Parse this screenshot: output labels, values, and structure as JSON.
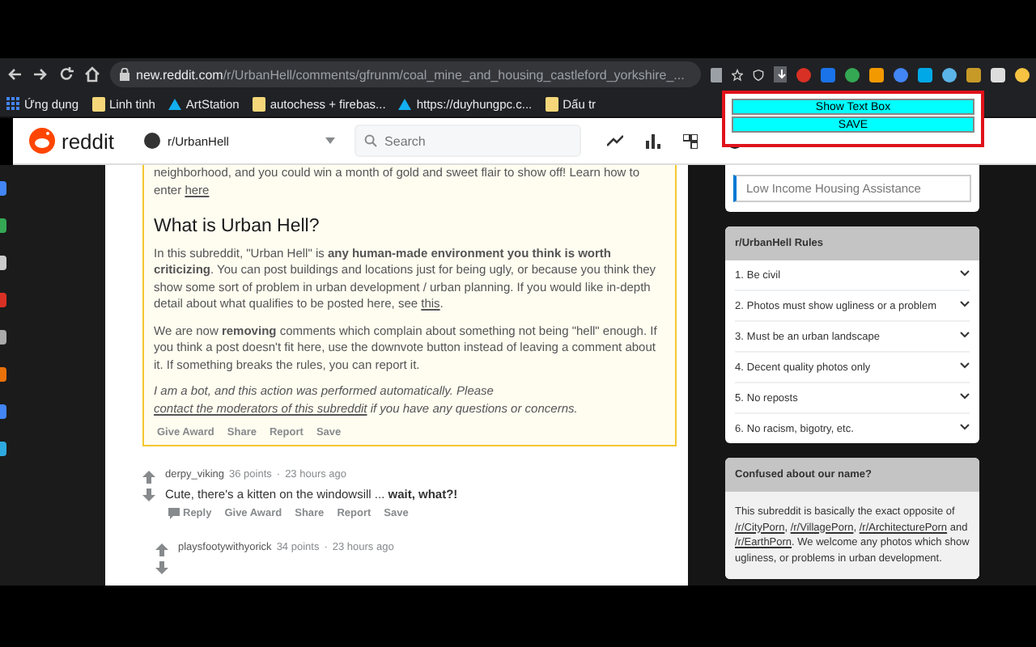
{
  "browser": {
    "url_domain": "new.reddit.com",
    "url_path": "/r/UrbanHell/comments/gfrunm/coal_mine_and_housing_castleford_yorkshire_..."
  },
  "bookmarks": [
    {
      "label": "Ứng dụng",
      "kind": "apps"
    },
    {
      "label": "Linh tinh",
      "kind": "folder"
    },
    {
      "label": "ArtStation",
      "kind": "site"
    },
    {
      "label": "autochess + firebas...",
      "kind": "folder"
    },
    {
      "label": "https://duyhungpc.c...",
      "kind": "site"
    },
    {
      "label": "Dấu tr",
      "kind": "folder"
    }
  ],
  "extension_popup": {
    "buttons": [
      "Show Text Box",
      "SAVE"
    ]
  },
  "header": {
    "logo": "reddit",
    "community": "r/UrbanHell",
    "search": {
      "placeholder": "Search"
    }
  },
  "post_card": {
    "intro": [
      {
        "kind": "text",
        "text": "neighborhood, and you could win a month of gold and sweet flair to show off! Learn how to enter "
      },
      {
        "kind": "link",
        "text": "here"
      }
    ],
    "heading": "What is Urban Hell?",
    "paragraphs": [
      [
        {
          "kind": "text",
          "text": "In this subreddit, \"Urban Hell\" is **any human-made environment you think is worth criticizing**. You can post buildings and locations just for being ugly, or because you think they show some sort of problem in urban development / urban planning. If you would like in-depth detail about what qualifies to be posted here, see "
        },
        {
          "kind": "link",
          "text": "this"
        },
        {
          "kind": "text",
          "text": "."
        }
      ],
      [
        {
          "kind": "text",
          "text": "We are now **removing** comments which complain about something not being \"hell\" enough. If you think a post doesn't fit here, use the downvote button instead of leaving a comment about it. If something breaks the rules, you can report it."
        }
      ]
    ],
    "bot_note": [
      {
        "kind": "text",
        "text": "I am a bot, and this action was performed automatically. Please "
      },
      {
        "kind": "link",
        "text": "contact the moderators of this subreddit"
      },
      {
        "kind": "text",
        "text": " if you have any questions or concerns."
      }
    ],
    "actions": [
      "Give Award",
      "Share",
      "Report",
      "Save"
    ]
  },
  "comments": [
    {
      "author": "derpy_viking",
      "points": "36 points",
      "separator": "·",
      "time": "23 hours ago",
      "body": "Cute, there's a kitten on the windowsill ... **wait, what?!**",
      "actions": [
        "Reply",
        "Give Award",
        "Share",
        "Report",
        "Save"
      ],
      "children": [
        {
          "author": "playsfootywithyorick",
          "points": "34 points",
          "separator": "·",
          "time": "23 hours ago"
        }
      ]
    }
  ],
  "sidebar": {
    "search_widget": {
      "value": "Low Income Housing Assistance"
    },
    "rules": {
      "title": "r/UrbanHell Rules",
      "items": [
        {
          "number": "1.",
          "text": "Be civil",
          "expanded": false
        },
        {
          "number": "2.",
          "text": "Photos must show ugliness or a problem",
          "expanded": false
        },
        {
          "number": "3.",
          "text": "Must be an urban landscape",
          "expanded": false
        },
        {
          "number": "4.",
          "text": "Decent quality photos only",
          "expanded": false
        },
        {
          "number": "5.",
          "text": "No reposts",
          "expanded": false
        },
        {
          "number": "6.",
          "text": "No racism, bigotry, etc.",
          "expanded": false
        }
      ]
    },
    "about": {
      "title": "Confused about our name?",
      "text": [
        {
          "kind": "text",
          "text": "This subreddit is basically the exact opposite of "
        },
        {
          "kind": "link",
          "text": "/r/CityPorn"
        },
        {
          "kind": "text",
          "text": ", "
        },
        {
          "kind": "link",
          "text": "/r/VillagePorn"
        },
        {
          "kind": "text",
          "text": ", "
        },
        {
          "kind": "link",
          "text": "/r/ArchitecturePorn"
        },
        {
          "kind": "text",
          "text": " and "
        },
        {
          "kind": "link",
          "text": "/r/EarthPorn"
        },
        {
          "kind": "text",
          "text": ". We welcome any photos which show ugliness, or problems in urban development."
        }
      ]
    }
  }
}
